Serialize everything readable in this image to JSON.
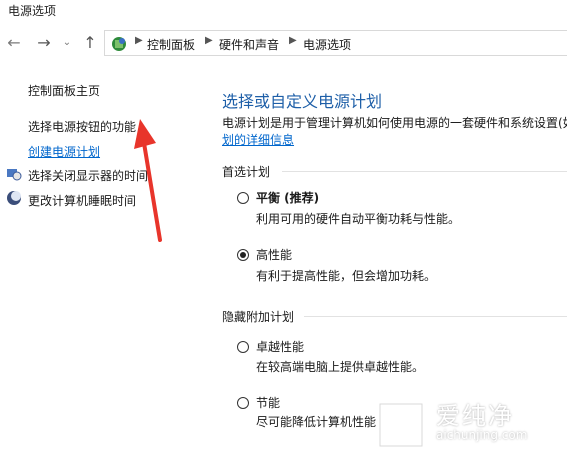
{
  "window": {
    "title": "电源选项"
  },
  "nav": {
    "breadcrumbs": [
      "控制面板",
      "硬件和声音",
      "电源选项"
    ]
  },
  "sidebar": {
    "items": [
      {
        "label": "控制面板主页"
      },
      {
        "label": "选择电源按钮的功能"
      },
      {
        "label": "创建电源计划"
      },
      {
        "label": "选择关闭显示器的时间"
      },
      {
        "label": "更改计算机睡眠时间"
      }
    ]
  },
  "main": {
    "title": "选择或自定义电源计划",
    "description": "电源计划是用于管理计算机如何使用电源的一套硬件和系统设置(如",
    "description_link": "划的详细信息",
    "preferred_label": "首选计划",
    "hidden_label": "隐藏附加计划",
    "plans": [
      {
        "name": "平衡 (推荐)",
        "desc": "利用可用的硬件自动平衡功耗与性能。",
        "checked": false
      },
      {
        "name": "高性能",
        "desc": "有利于提高性能，但会增加功耗。",
        "checked": true
      },
      {
        "name": "卓越性能",
        "desc": "在较高端电脑上提供卓越性能。",
        "checked": false
      },
      {
        "name": "节能",
        "desc": "尽可能降低计算机性能",
        "checked": false
      }
    ]
  },
  "watermark": {
    "brand": "爱纯净",
    "url": "aichunjing.com"
  },
  "colors": {
    "accent": "#1e5fa8",
    "link": "#0066cc",
    "annotation": "#e8352b"
  }
}
